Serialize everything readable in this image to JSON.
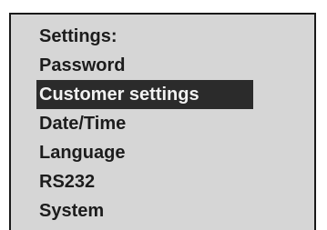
{
  "menu": {
    "title": "Settings:",
    "items": [
      {
        "label": "Password",
        "selected": false
      },
      {
        "label": "Customer settings",
        "selected": true
      },
      {
        "label": "Date/Time",
        "selected": false
      },
      {
        "label": "Language",
        "selected": false
      },
      {
        "label": "RS232",
        "selected": false
      },
      {
        "label": "System",
        "selected": false
      }
    ]
  },
  "colors": {
    "screen_background": "#d6d6d6",
    "highlight_background": "#2b2b2b",
    "highlight_text": "#f2f2f2",
    "text": "#1c1c1c"
  }
}
